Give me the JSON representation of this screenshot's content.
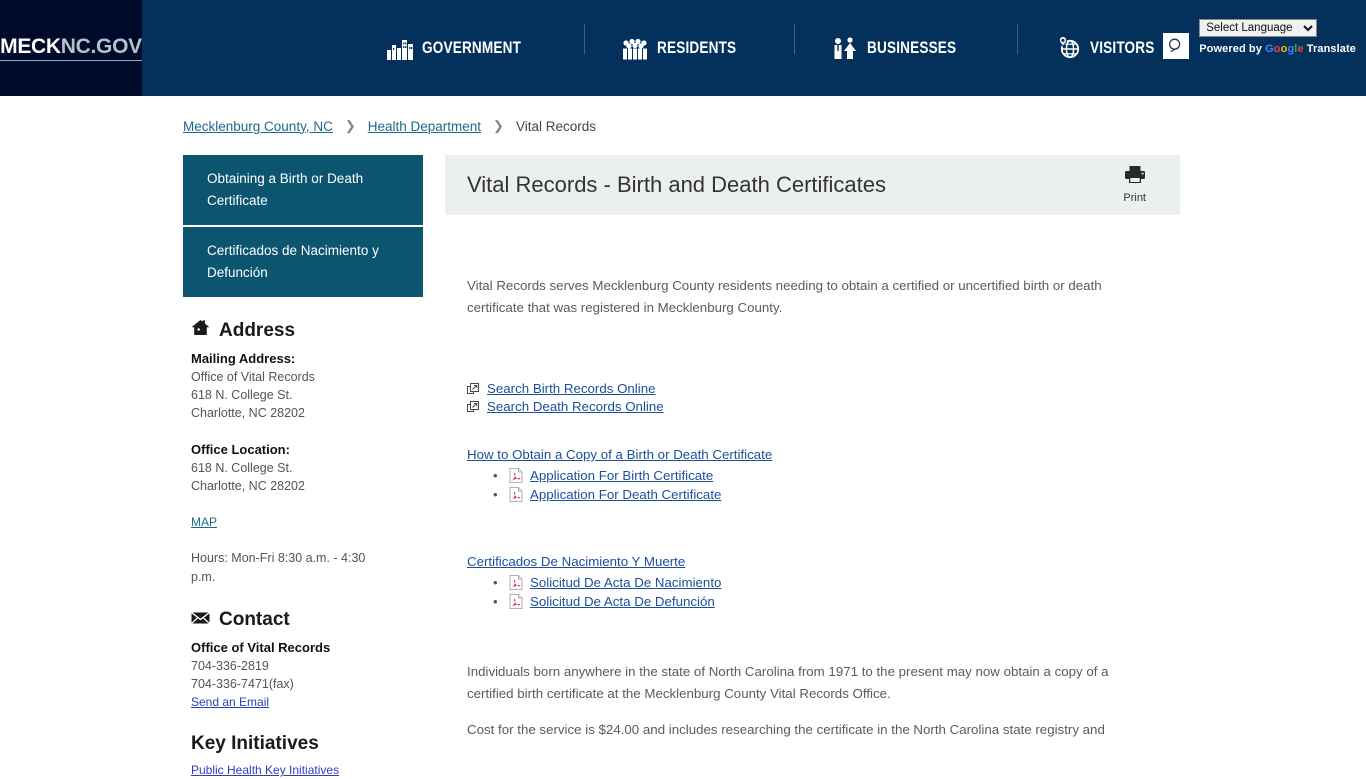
{
  "header": {
    "logo": {
      "bold": "MECK",
      "light": "NC.GOV"
    },
    "nav": [
      {
        "label": "GOVERNMENT",
        "icon": "buildings-icon"
      },
      {
        "label": "RESIDENTS",
        "icon": "people-icon"
      },
      {
        "label": "BUSINESSES",
        "icon": "business-people-icon"
      },
      {
        "label": "VISITORS",
        "icon": "globe-pin-icon"
      }
    ],
    "search_icon": "search-icon",
    "translate": {
      "selected": "Select Language",
      "options": [
        "Select Language"
      ],
      "powered_prefix": "Powered by",
      "google": "Google",
      "translate_word": "Translate"
    }
  },
  "breadcrumb": {
    "items": [
      {
        "label": "Mecklenburg County, NC",
        "link": true
      },
      {
        "label": "Health Department",
        "link": true
      },
      {
        "label": "Vital Records",
        "link": false
      }
    ],
    "separator": "❯"
  },
  "sidebar": {
    "nav_items": [
      {
        "label": "Obtaining a Birth or Death Certificate"
      },
      {
        "label": "Certificados de Nacimiento y Defunción"
      }
    ],
    "address": {
      "heading": "Address",
      "icon": "home-icon",
      "mailing_label": "Mailing Address:",
      "mailing_lines": [
        "Office of Vital Records",
        "618 N. College St.",
        "Charlotte, NC 28202"
      ],
      "office_label": "Office Location:",
      "office_lines": [
        "618 N. College St.",
        "Charlotte, NC 28202"
      ],
      "map_link": "MAP",
      "hours": "Hours: Mon-Fri 8:30 a.m. - 4:30 p.m."
    },
    "contact": {
      "heading": "Contact",
      "icon": "envelope-icon",
      "office": "Office of Vital Records",
      "phone": "704-336-2819",
      "fax": "704-336-7471(fax)",
      "email_link": "Send an Email"
    },
    "key_initiatives": {
      "heading": "Key Initiatives",
      "link": "Public Health Key Initiatives"
    }
  },
  "content": {
    "title": "Vital Records - Birth and Death Certificates",
    "print_label": "Print",
    "print_icon": "printer-icon",
    "intro": "Vital Records serves Mecklenburg County residents needing to obtain a certified or uncertified birth or death certificate that was registered in Mecklenburg County.",
    "external_links": [
      {
        "label": "Search Birth Records Online",
        "icon": "external-link-icon"
      },
      {
        "label": "Search Death Records Online",
        "icon": "external-link-icon"
      }
    ],
    "english_section": {
      "heading_link": "How to Obtain a Copy of a Birth or Death Certificate",
      "documents": [
        {
          "label": "Application For Birth Certificate",
          "icon": "pdf-icon"
        },
        {
          "label": "Application For Death Certificate",
          "icon": "pdf-icon"
        }
      ]
    },
    "spanish_section": {
      "heading_link": "Certificados De Nacimiento Y Muerte",
      "documents": [
        {
          "label": "Solicitud De Acta De Nacimiento",
          "icon": "pdf-icon"
        },
        {
          "label": "Solicitud De Acta De Defunción",
          "icon": "pdf-icon"
        }
      ]
    },
    "paragraph_born": "Individuals born anywhere in the state of North Carolina from 1971 to the present may now obtain a copy of a certified birth certificate at the Mecklenburg County Vital Records Office.",
    "paragraph_cost": "Cost for the service is $24.00 and includes researching the certificate in the North Carolina state registry and"
  },
  "colors": {
    "header_navy": "#04305c",
    "logo_block": "#000b2b",
    "sidebar_teal": "#0c5571",
    "content_header_gray": "#eceff0",
    "link_blue": "#1c4f9c",
    "crumb_teal": "#1b6a8c"
  }
}
